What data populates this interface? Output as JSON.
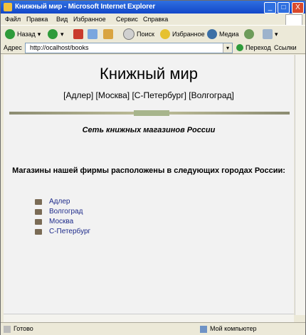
{
  "window": {
    "title": "Книжный мир - Microsoft Internet Explorer",
    "controls": {
      "minimize": "_",
      "maximize": "□",
      "close": "X"
    }
  },
  "menu": {
    "items": [
      "Файл",
      "Правка",
      "Вид",
      "Избранное",
      "Сервис",
      "Справка"
    ]
  },
  "toolbar": {
    "back_label": "Назад",
    "search_label": "Поиск",
    "favorites_label": "Избранное",
    "media_label": "Медиа"
  },
  "address": {
    "label": "Адрес",
    "value": "http://ocalhost/books",
    "go_label": "Переход",
    "links_label": "Ссылки"
  },
  "page": {
    "title": "Книжный мир",
    "cities_line": "[Адлер] [Москва] [С-Петербург] [Волгоград]",
    "tagline": "Сеть книжных магазинов России",
    "lead": "Магазины нашей фирмы расположены в следующих городах России:",
    "cities": [
      "Адлер",
      "Волгоград",
      "Москва",
      "С-Петербург"
    ]
  },
  "status": {
    "left": "Готово",
    "zone": "Мой компьютер"
  },
  "icons": {
    "back": "back-arrow-icon",
    "forward": "forward-arrow-icon",
    "stop": "stop-icon",
    "refresh": "refresh-icon",
    "home": "home-icon",
    "search": "search-icon",
    "favorites": "star-icon",
    "media": "media-icon",
    "history": "history-icon",
    "mail": "mail-icon"
  },
  "colors": {
    "titlebar": "#1f5fd9",
    "link": "#1d2a8a",
    "bullet": "#7a6b55"
  }
}
